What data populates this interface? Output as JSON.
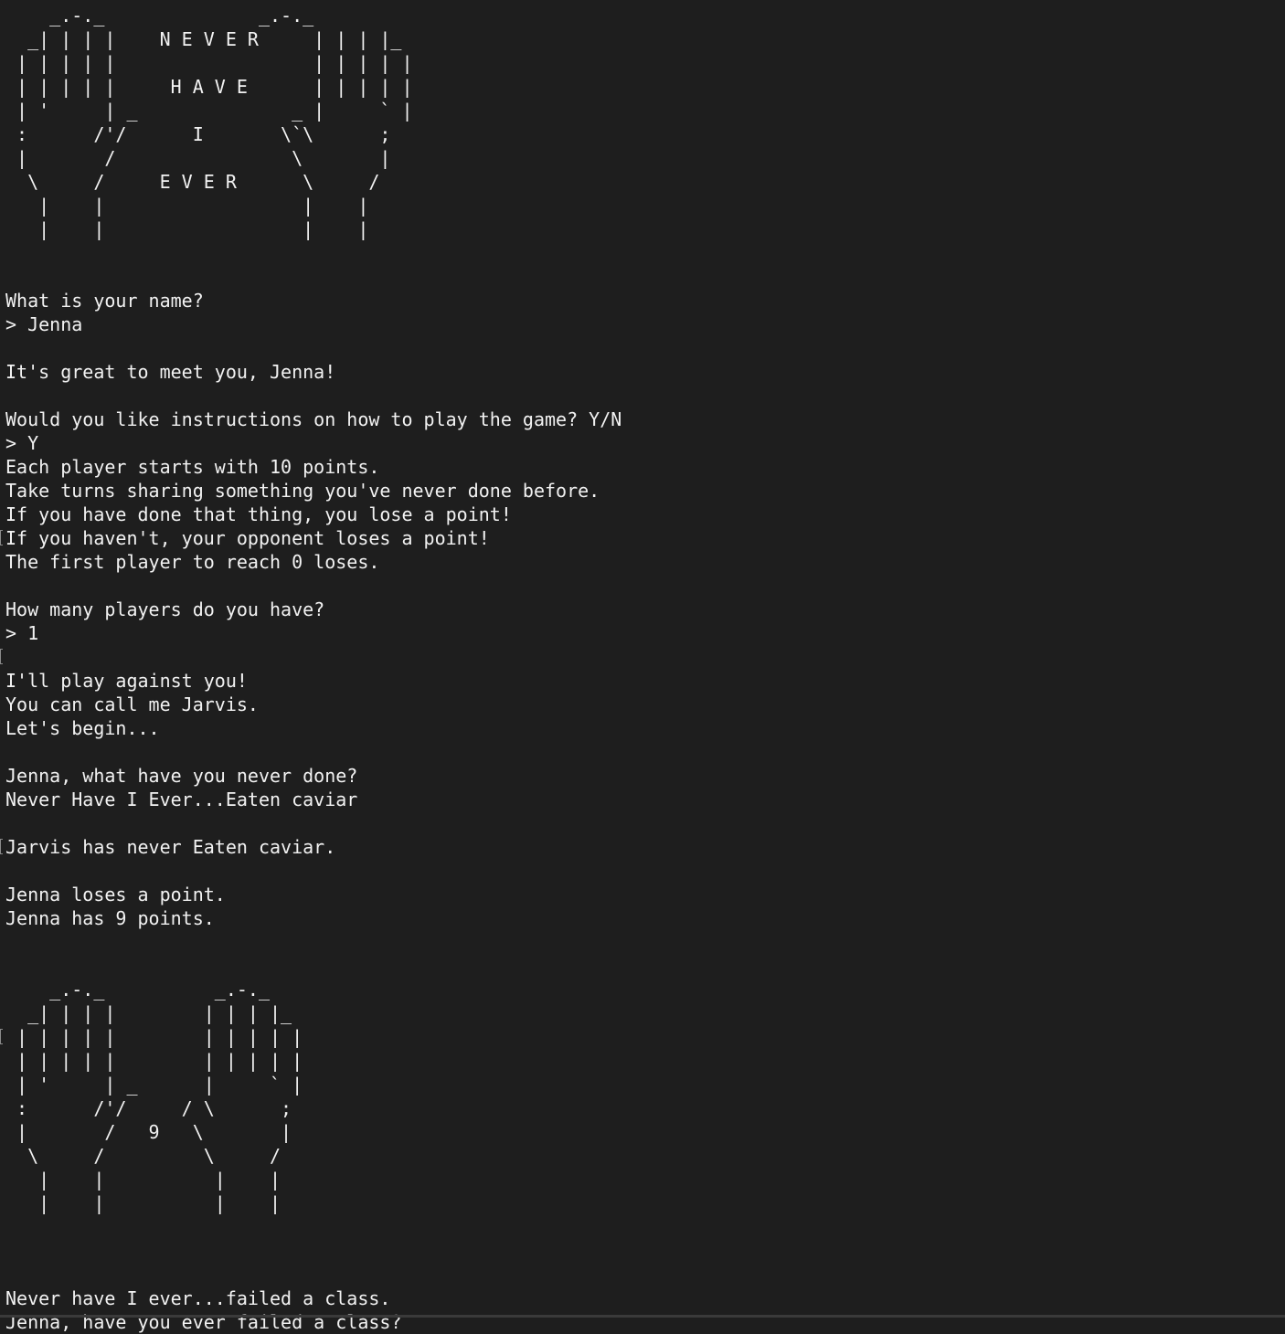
{
  "terminal": {
    "lines": [
      "    _.-._              _.-._",
      "  _| | | |    N E V E R     | | | |_",
      " | | | | |                  | | | | |",
      " | | | | |     H A V E      | | | | |",
      " | '     | _              _ |     ` |",
      " :      /'/      I       \\`\\      ;",
      " |       /                \\       |",
      "  \\     /     E V E R      \\     /",
      "   |    |                  |    |",
      "   |    |                  |    |",
      "",
      "",
      "What is your name?",
      "> Jenna",
      "",
      "It's great to meet you, Jenna!",
      "",
      "Would you like instructions on how to play the game? Y/N",
      "> Y",
      "Each player starts with 10 points.",
      "Take turns sharing something you've never done before.",
      "If you have done that thing, you lose a point!",
      "If you haven't, your opponent loses a point!",
      "The first player to reach 0 loses.",
      "",
      "How many players do you have?",
      "> 1",
      "",
      "I'll play against you!",
      "You can call me Jarvis.",
      "Let's begin...",
      "",
      "Jenna, what have you never done?",
      "Never Have I Ever...Eaten caviar",
      "",
      "Jarvis has never Eaten caviar.",
      "",
      "Jenna loses a point.",
      "Jenna has 9 points.",
      "",
      "",
      "    _.-._          _.-._",
      "  _| | | |        | | | |_",
      " | | | | |        | | | | |",
      " | | | | |        | | | | |",
      " | '     | _      |     ` |",
      " :      /'/     / \\      ;",
      " |       /   9   \\       |",
      "  \\     /         \\     /",
      "   |    |          |    |",
      "   |    |          |    |",
      "",
      "",
      "",
      "Never have I ever...failed a class.",
      "Jenna, have you ever failed a class?"
    ]
  }
}
